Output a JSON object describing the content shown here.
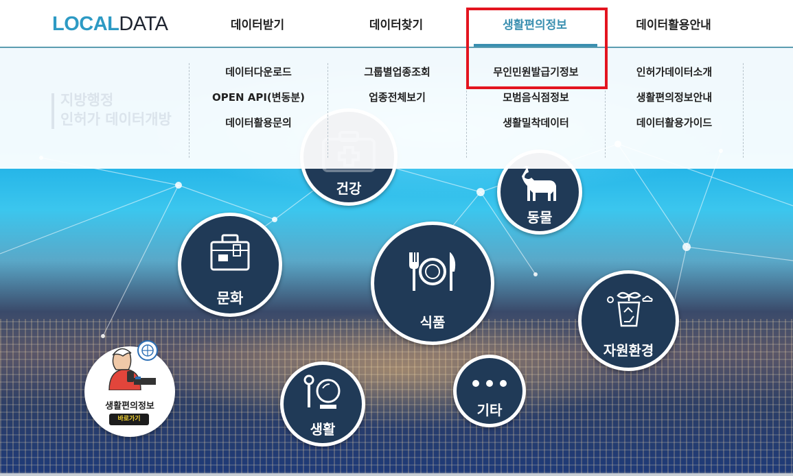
{
  "header": {
    "logo": {
      "part1": "LOCAL",
      "part2": "DATA"
    },
    "nav": [
      {
        "label": "데이터받기"
      },
      {
        "label": "데이터찾기"
      },
      {
        "label": "생활편의정보"
      },
      {
        "label": "데이터활용안내"
      }
    ],
    "active_index": 2,
    "accent_color": "#3a8fb0",
    "highlight_color": "#e3141f"
  },
  "dropdown": {
    "columns": [
      {
        "items": [
          "데이터다운로드",
          "OPEN API(변동분)",
          "데이터활용문의"
        ]
      },
      {
        "items": [
          "그룹별업종조회",
          "업종전체보기"
        ]
      },
      {
        "items": [
          "무인민원발급기정보",
          "모범음식점정보",
          "생활밀착데이터"
        ]
      },
      {
        "items": [
          "인허가데이터소개",
          "생활편의정보안내",
          "데이터활용가이드"
        ]
      }
    ]
  },
  "hero": {
    "title_line1": "지방행정",
    "title_line2": "인허가 데이터개방"
  },
  "categories": [
    {
      "label": "건강",
      "icon": "medical-kit-icon"
    },
    {
      "label": "동물",
      "icon": "goat-icon"
    },
    {
      "label": "문화",
      "icon": "suitcase-icon"
    },
    {
      "label": "식품",
      "icon": "fork-plate-knife-icon"
    },
    {
      "label": "자원환경",
      "icon": "recycle-plant-icon"
    },
    {
      "label": "생활",
      "icon": "mirror-brush-icon"
    },
    {
      "label": "기타",
      "icon": "dots-icon"
    }
  ],
  "shortcut": {
    "title": "생활편의정보",
    "button": "바로가기",
    "icon": "woman-with-phone-icon"
  },
  "colors": {
    "circle_bg": "#203a57",
    "logo_blue": "#2d9ac4",
    "logo_dark": "#1e2430"
  }
}
